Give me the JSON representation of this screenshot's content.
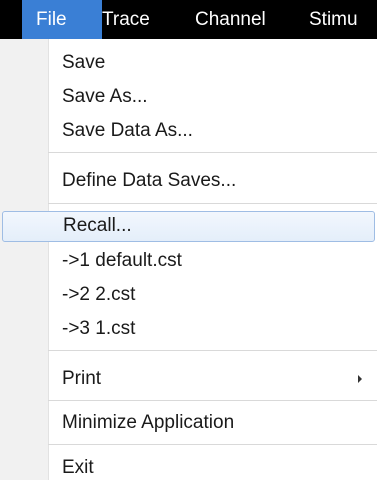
{
  "menubar": {
    "items": [
      {
        "label": "File"
      },
      {
        "label": "Trace"
      },
      {
        "label": "Channel"
      },
      {
        "label": "Stimu"
      }
    ],
    "active_index": 0
  },
  "file_menu": {
    "items": [
      {
        "label": "Save"
      },
      {
        "label": "Save As..."
      },
      {
        "label": "Save Data As..."
      },
      {
        "label": "Define Data Saves..."
      },
      {
        "label": "Recall..."
      },
      {
        "label": "->1 default.cst"
      },
      {
        "label": "->2 2.cst"
      },
      {
        "label": "->3 1.cst"
      },
      {
        "label": "Print",
        "submenu_icon": "submenu-arrow-icon"
      },
      {
        "label": "Minimize Application"
      },
      {
        "label": "Exit"
      }
    ],
    "highlighted": "Recall..."
  },
  "colors": {
    "menubar_bg": "#000000",
    "active_menu_bg": "#3a7fd5",
    "highlight_border": "#9fbde4"
  }
}
